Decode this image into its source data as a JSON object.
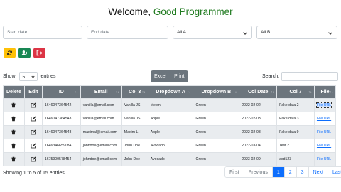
{
  "header": {
    "welcome": "Welcome,",
    "name": "Good Programmer"
  },
  "filters": {
    "start_date_placeholder": "Start date",
    "end_date_placeholder": "End date",
    "select_a": "All A",
    "select_b": "All B"
  },
  "toolbar": {
    "refresh_icon": "refresh-icon",
    "add_user_icon": "add-user-icon",
    "logout_icon": "sign-out-icon",
    "colors": [
      "#ffc107",
      "#198754",
      "#dc3545"
    ]
  },
  "length": {
    "prefix": "Show",
    "value": "5",
    "suffix": "entries"
  },
  "export": {
    "excel": "Excel",
    "print": "Print"
  },
  "search": {
    "label": "Search:"
  },
  "table": {
    "headers": [
      "Delete",
      "Edit",
      "ID",
      "Email",
      "Col 3",
      "Dropdown A",
      "Dropdown B",
      "Col Date",
      "Col 7",
      "File"
    ],
    "rows": [
      [
        "1646047364542",
        "vanilla@email.com",
        "Vanilla JS",
        "Melon",
        "Green",
        "2022-02-02",
        "Fake data 2",
        "File URL"
      ],
      [
        "1646047364543",
        "vanilla@email.com",
        "Vanilla JS",
        "Apple",
        "Green",
        "2022-02-03",
        "Fake data 3",
        "File URL"
      ],
      [
        "1646047364548",
        "maximal@email.com",
        "Maxim L",
        "Apple",
        "Green",
        "2022-02-08",
        "Fake data 9",
        "File URL"
      ],
      [
        "1646346659084",
        "johndoe@email.com",
        "John Doe",
        "Avocado",
        "Green",
        "2022-03-04",
        "Test 2",
        "File URL"
      ],
      [
        "1675900578454",
        "johndoe@email.com",
        "John Doe",
        "Avocado",
        "Green",
        "2023-02-09",
        "asd123",
        "File URL"
      ]
    ]
  },
  "info": "Showing 1 to 5 of 15 entries",
  "pagination": {
    "first": "First",
    "previous": "Previous",
    "pages": [
      "1",
      "2",
      "3"
    ],
    "next": "Next",
    "last": "Last",
    "active_page": "1"
  }
}
